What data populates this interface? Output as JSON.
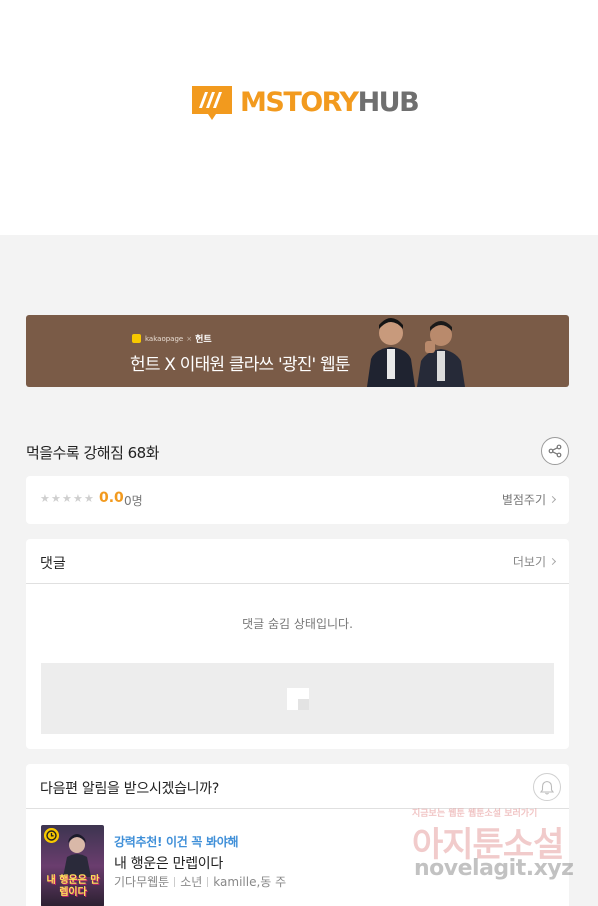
{
  "header": {
    "logo": {
      "text_m": "MSTORY",
      "text_h": "HUB"
    }
  },
  "banner": {
    "brand": "kakaopage",
    "brand_sep": "×",
    "brand_partner": "헌트",
    "title": "헌트 X 이태원 클라쓰 '광진' 웹툰"
  },
  "episode": {
    "title": "먹을수록 강해짐 68화"
  },
  "rating": {
    "score": "0.0",
    "count": "0명",
    "rate_label": "별점주기",
    "stars": 5
  },
  "comments": {
    "title": "댓글",
    "more_label": "더보기",
    "hidden_message": "댓글 숨김 상태입니다."
  },
  "notify": {
    "title": "다음편 알림을 받으시겠습니까?"
  },
  "recommend": {
    "tag": "강력추천! 이건 꼭 봐야해",
    "name": "내 행운은 만렙이다",
    "thumb_title": "내 행운은 만렙이다",
    "meta": [
      "기다무웹툰",
      "소년",
      "kamille,동 주"
    ]
  },
  "watermark": {
    "small": "지금보는 웹툰 웹툰소설 보러가기",
    "big": "아지툰소설",
    "url": "novelagit.xyz"
  },
  "colors": {
    "accent": "#f29a1e",
    "banner_bg": "#7a5b47",
    "link_blue": "#3f8fd8"
  }
}
